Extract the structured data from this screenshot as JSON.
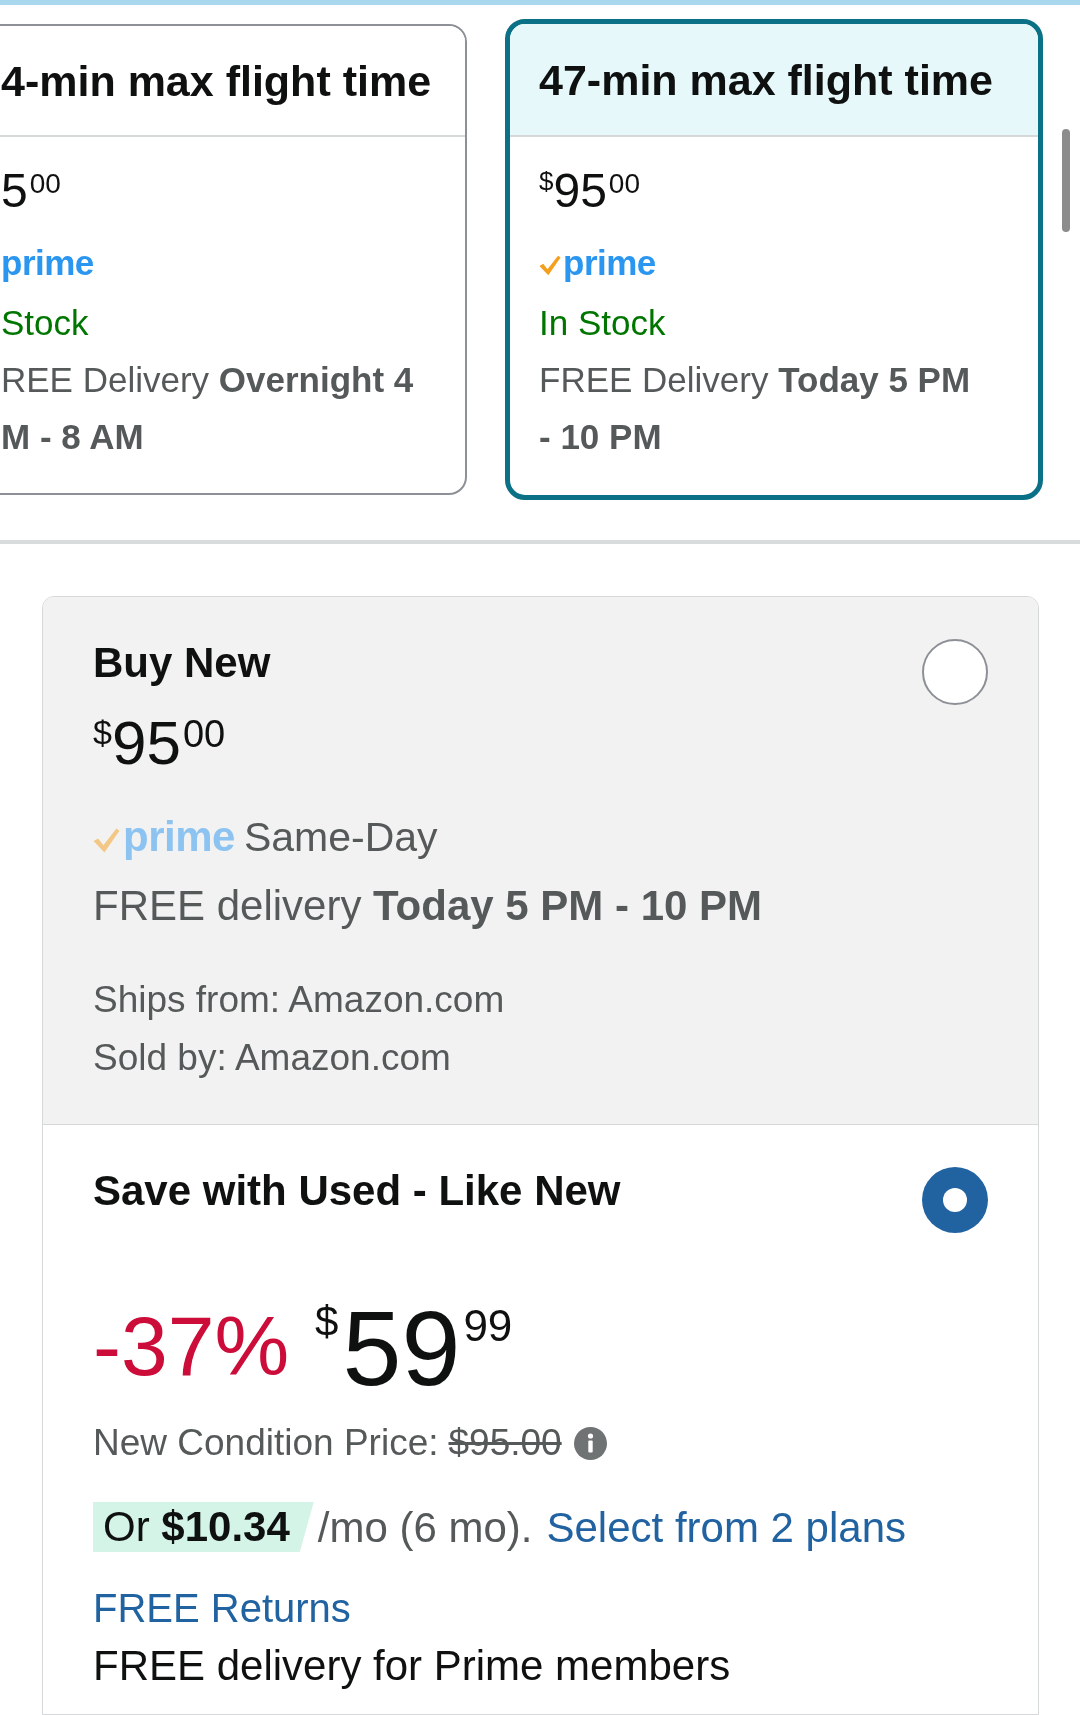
{
  "cards": [
    {
      "title": "4-min max flight time",
      "selected": false,
      "price": {
        "whole": "5",
        "fraction": "00"
      },
      "prime": {
        "check": false,
        "label": "prime"
      },
      "stock": "Stock",
      "delivery_lines": [
        "REE Delivery **Overnight 4**",
        "**M - 8 AM**"
      ]
    },
    {
      "title": "47-min max flight time",
      "selected": true,
      "price": {
        "symbol": "$",
        "whole": "95",
        "fraction": "00"
      },
      "prime": {
        "check": true,
        "label": "prime"
      },
      "stock": "In Stock",
      "delivery_lines": [
        "FREE Delivery **Today 5 PM**",
        "**- 10 PM**"
      ]
    }
  ],
  "options": [
    {
      "kind": "standard",
      "title": "Buy New",
      "selected": false,
      "price": {
        "symbol": "$",
        "whole": "95",
        "fraction": "00"
      },
      "prime": {
        "check": true,
        "label": "prime",
        "dimmed": true
      },
      "speed": "Same-Day",
      "delivery": "FREE delivery **Today 5 PM - 10 PM**",
      "ships_from": "Ships from: Amazon.com",
      "sold_by": "Sold by: Amazon.com"
    },
    {
      "kind": "deal",
      "title": "Save with Used - Like New",
      "selected": true,
      "discount": "-37%",
      "price": {
        "symbol": "$",
        "whole": "59",
        "fraction": "99"
      },
      "list_price_label": "New Condition Price:",
      "list_price": "$95.00",
      "installment": {
        "amount": "Or **$10.34**",
        "term": "/mo (6 mo).",
        "link": "Select from 2 plans"
      },
      "returns": "FREE Returns",
      "delivery": "FREE delivery for Prime members"
    }
  ]
}
